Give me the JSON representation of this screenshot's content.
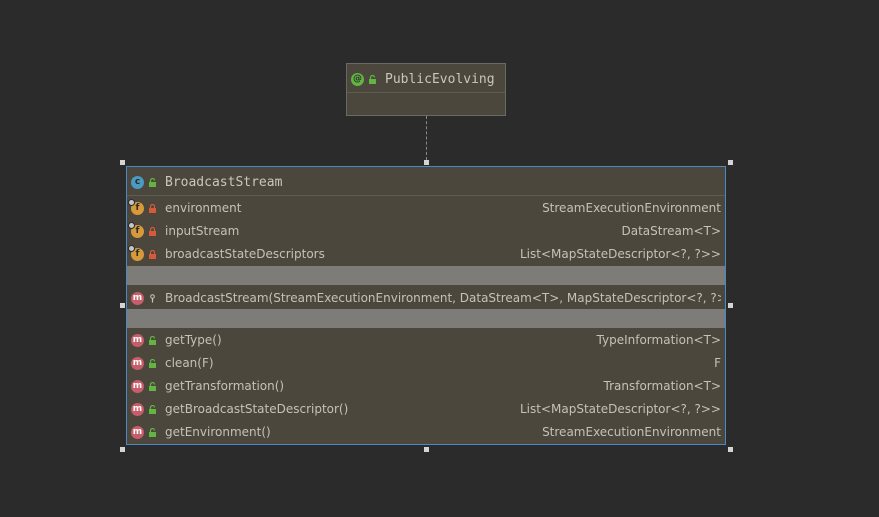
{
  "annotation": {
    "name": "PublicEvolving",
    "badge": "@"
  },
  "class": {
    "name": "BroadcastStream",
    "badge": "c",
    "fields": [
      {
        "badge": "f",
        "name": "environment",
        "type": "StreamExecutionEnvironment"
      },
      {
        "badge": "f",
        "name": "inputStream",
        "type": "DataStream<T>"
      },
      {
        "badge": "f",
        "name": "broadcastStateDescriptors",
        "type": "List<MapStateDescriptor<?, ?>>"
      }
    ],
    "constructors": [
      {
        "badge": "m",
        "name": "BroadcastStream(StreamExecutionEnvironment, DataStream<T>, MapStateDescriptor<?, ?>...)",
        "type": ""
      }
    ],
    "methods": [
      {
        "badge": "m",
        "name": "getType()",
        "type": "TypeInformation<T>"
      },
      {
        "badge": "m",
        "name": "clean(F)",
        "type": "F"
      },
      {
        "badge": "m",
        "name": "getTransformation()",
        "type": "Transformation<T>"
      },
      {
        "badge": "m",
        "name": "getBroadcastStateDescriptor()",
        "type": "List<MapStateDescriptor<?, ?>>"
      },
      {
        "badge": "m",
        "name": "getEnvironment()",
        "type": "StreamExecutionEnvironment"
      }
    ]
  },
  "colors": {
    "background": "#2b2b2b",
    "node": "#4b473c",
    "selection": "#4a88c7",
    "separator": "#7d7c79"
  }
}
